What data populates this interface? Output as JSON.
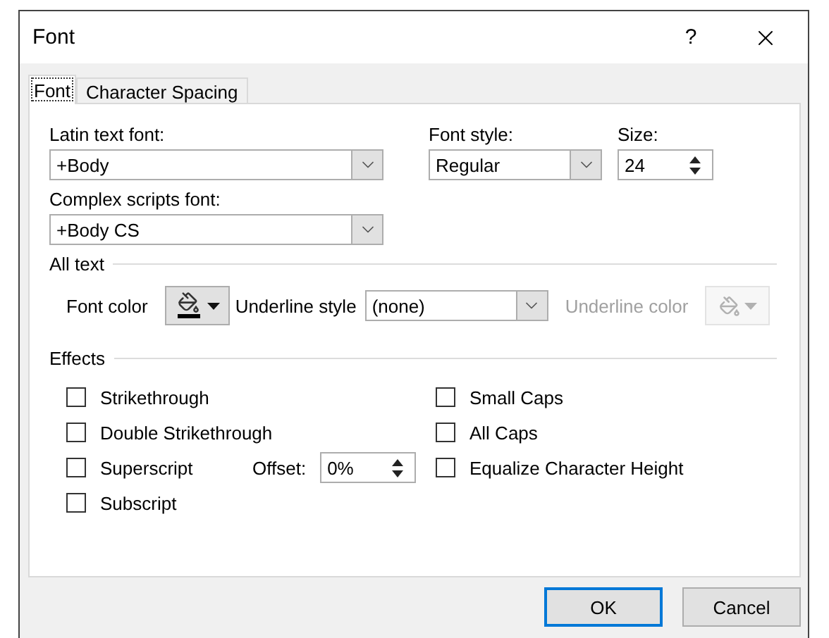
{
  "window": {
    "title": "Font",
    "help": "?"
  },
  "tabs": [
    {
      "label": "Font",
      "selected": true
    },
    {
      "label": "Character Spacing",
      "selected": false
    }
  ],
  "latin_font": {
    "label": "Latin text font:",
    "value": "+Body"
  },
  "font_style": {
    "label": "Font style:",
    "value": "Regular"
  },
  "size": {
    "label": "Size:",
    "value": "24"
  },
  "complex_font": {
    "label": "Complex scripts font:",
    "value": "+Body CS"
  },
  "all_text": {
    "heading": "All text",
    "font_color_label": "Font color",
    "underline_style": {
      "label": "Underline style",
      "value": "(none)"
    },
    "underline_color": {
      "label": "Underline color",
      "disabled": true
    }
  },
  "effects": {
    "heading": "Effects",
    "left": [
      {
        "label": "Strikethrough",
        "checked": false
      },
      {
        "label": "Double Strikethrough",
        "checked": false
      },
      {
        "label": "Superscript",
        "checked": false
      },
      {
        "label": "Subscript",
        "checked": false
      }
    ],
    "offset": {
      "label": "Offset:",
      "value": "0%"
    },
    "right": [
      {
        "label": "Small Caps",
        "checked": false
      },
      {
        "label": "All Caps",
        "checked": false
      },
      {
        "label": "Equalize Character Height",
        "checked": false
      }
    ]
  },
  "buttons": [
    {
      "label": "OK",
      "default": true
    },
    {
      "label": "Cancel",
      "default": false
    }
  ]
}
